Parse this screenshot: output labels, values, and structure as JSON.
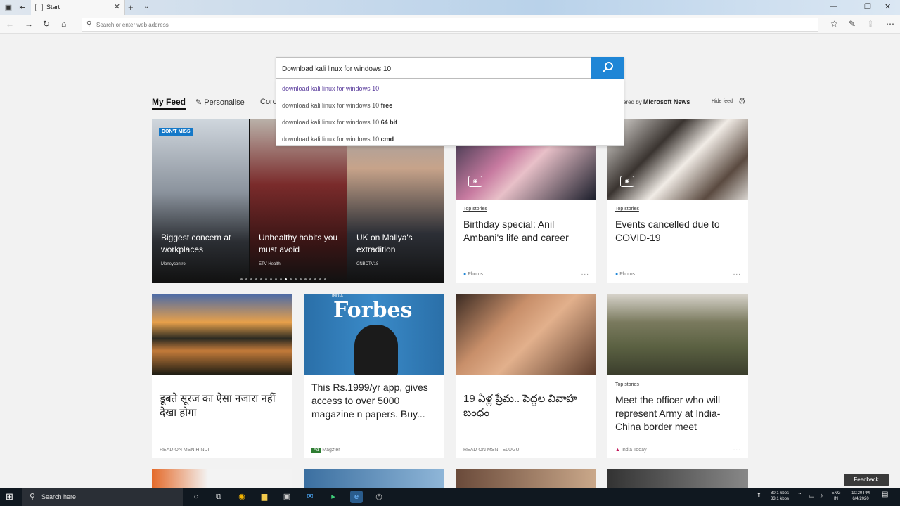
{
  "browser": {
    "tab_title": "Start",
    "address_placeholder": "Search or enter web address"
  },
  "search": {
    "query": "Download kali linux for windows 10",
    "suggestions": [
      {
        "base": "download kali linux for windows 10",
        "bold": ""
      },
      {
        "base": "download kali linux for windows 10",
        "bold": "free"
      },
      {
        "base": "download kali linux for windows 10",
        "bold": "64 bit"
      },
      {
        "base": "download kali linux for windows 10",
        "bold": "cmd"
      }
    ]
  },
  "feed": {
    "my_feed": "My Feed",
    "personalise": "Personalise",
    "partial_tab": "Coro",
    "powered_prefix": "ered by",
    "powered_brand": "Microsoft News",
    "hide_feed": "Hide feed"
  },
  "hero": {
    "badge": "DON'T MISS",
    "slides": [
      {
        "title": "Biggest concern at workplaces",
        "source": "Moneycontrol"
      },
      {
        "title": "Unhealthy habits you must avoid",
        "source": "ETV Health"
      },
      {
        "title": "UK on Mallya's extradition",
        "source": "CNBCTV18"
      }
    ]
  },
  "cards": [
    {
      "category": "Top stories",
      "title": "Birthday special: Anil Ambani's life and career",
      "source": "Photos",
      "more": "..."
    },
    {
      "category": "Top stories",
      "title": "Events cancelled due to COVID-19",
      "source": "Photos",
      "more": "..."
    },
    {
      "category": "",
      "title": "डूबते सूरज का ऐसा नजारा नहीं देखा होगा",
      "source": "READ ON MSN HINDI",
      "more": ""
    },
    {
      "category": "",
      "title": "This Rs.1999/yr app, gives access to over 5000 magazine n papers. Buy...",
      "source": "Magzter",
      "ad": "Ad",
      "more": ""
    },
    {
      "category": "",
      "title": "19 ఏళ్ల ప్రేమ.. పెద్దల వివాహ బంధం",
      "source": "READ ON MSN TELUGU",
      "more": ""
    },
    {
      "category": "Top stories",
      "title": "Meet the officer who will represent Army at India-China border meet",
      "source": "India Today",
      "more": "..."
    }
  ],
  "forbes_cover": {
    "brand": "Forbes",
    "region": "INDIA"
  },
  "feedback": "Feedback",
  "taskbar": {
    "search_placeholder": "Search here",
    "net_up": "80.1 kbps",
    "net_down": "33.1 kbps",
    "lang": "ENG",
    "region": "IN",
    "time": "10:20 PM",
    "date": "6/4/2020"
  },
  "colors": {
    "search_button": "#1f86d6",
    "badge": "#1478c8",
    "taskbar": "#101820"
  }
}
